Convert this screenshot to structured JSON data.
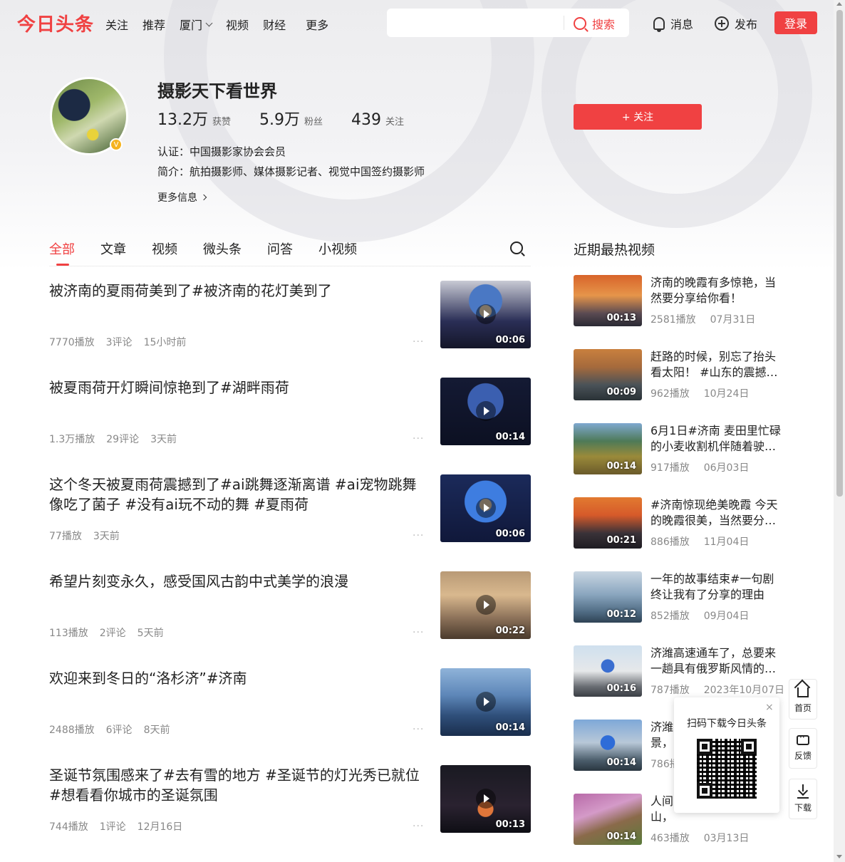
{
  "header": {
    "logo": "今日头条",
    "nav": [
      "关注",
      "推荐",
      "厦门",
      "视频",
      "财经"
    ],
    "nav_more": "更多",
    "search_placeholder": "",
    "search_label": "搜索",
    "messages_label": "消息",
    "publish_label": "发布",
    "login_label": "登录"
  },
  "profile": {
    "name": "摄影天下看世界",
    "likes_num": "13.2万",
    "likes_label": "获赞",
    "fans_num": "5.9万",
    "fans_label": "粉丝",
    "following_num": "439",
    "following_label": "关注",
    "follow_button": "+ 关注",
    "cert": "认证：中国摄影家协会会员",
    "bio": "简介：航拍摄影师、媒体摄影记者、视觉中国签约摄影师",
    "more_info": "更多信息",
    "badge": "V"
  },
  "tabs": [
    "全部",
    "文章",
    "视频",
    "微头条",
    "问答",
    "小视频"
  ],
  "feed": [
    {
      "title": "被济南的夏雨荷美到了#被济南的花灯美到了",
      "plays": "7770播放",
      "comments": "3评论",
      "time": "15小时前",
      "duration": "00:06"
    },
    {
      "title": "被夏雨荷开灯瞬间惊艳到了#湖畔雨荷",
      "plays": "1.3万播放",
      "comments": "29评论",
      "time": "3天前",
      "duration": "00:14"
    },
    {
      "title": "这个冬天被夏雨荷震撼到了#ai跳舞逐渐离谱 #ai宠物跳舞像吃了菌子 #没有ai玩不动的舞 #夏雨荷",
      "plays": "77播放",
      "comments": "",
      "time": "3天前",
      "duration": "00:06"
    },
    {
      "title": "希望片刻变永久，感受国风古韵中式美学的浪漫",
      "plays": "113播放",
      "comments": "2评论",
      "time": "5天前",
      "duration": "00:22"
    },
    {
      "title": "欢迎来到冬日的“洛杉济”#济南",
      "plays": "2488播放",
      "comments": "6评论",
      "time": "8天前",
      "duration": "00:14"
    },
    {
      "title": "圣诞节氛围感来了#去有雪的地方 #圣诞节的灯光秀已就位 #想看看你城市的圣诞氛围",
      "plays": "744播放",
      "comments": "1评论",
      "time": "12月16日",
      "duration": "00:13"
    }
  ],
  "sidebar": {
    "title": "近期最热视频",
    "items": [
      {
        "text": "济南的晚霞有多惊艳，当然要分享给你看！",
        "plays": "2581播放",
        "date": "07月31日",
        "duration": "00:13"
      },
      {
        "text": "赶路的时候，别忘了抬头看太阳！ #山东的震撼…",
        "plays": "962播放",
        "date": "10月24日",
        "duration": "00:09"
      },
      {
        "text": "6月1日#济南 麦田里忙碌的小麦收割机伴随着驶…",
        "plays": "917播放",
        "date": "06月03日",
        "duration": "00:14"
      },
      {
        "text": "#济南惊现绝美晚霞 今天的晚霞很美，当然要分…",
        "plays": "886播放",
        "date": "11月04日",
        "duration": "00:21"
      },
      {
        "text": "一年的故事结束#一句剧终让我有了分享的理由",
        "plays": "852播放",
        "date": "09月04日",
        "duration": "00:12"
      },
      {
        "text": "济潍高速通车了，总要来一趟具有俄罗斯风情的…",
        "plays": "787播放",
        "date": "2023年10月07日",
        "duration": "00:16"
      },
      {
        "text": "济潍",
        "text2": "景，",
        "plays": "786播",
        "date": "",
        "duration": "00:14"
      },
      {
        "text": "人间",
        "text2": "山，",
        "plays": "463播放",
        "date": "03月13日",
        "duration": "00:14"
      }
    ]
  },
  "tools": {
    "home": "首页",
    "feedback": "反馈",
    "download": "下载"
  },
  "qr": {
    "title": "扫码下载今日头条",
    "close": "×"
  },
  "colors": {
    "brand": "#f04142"
  }
}
